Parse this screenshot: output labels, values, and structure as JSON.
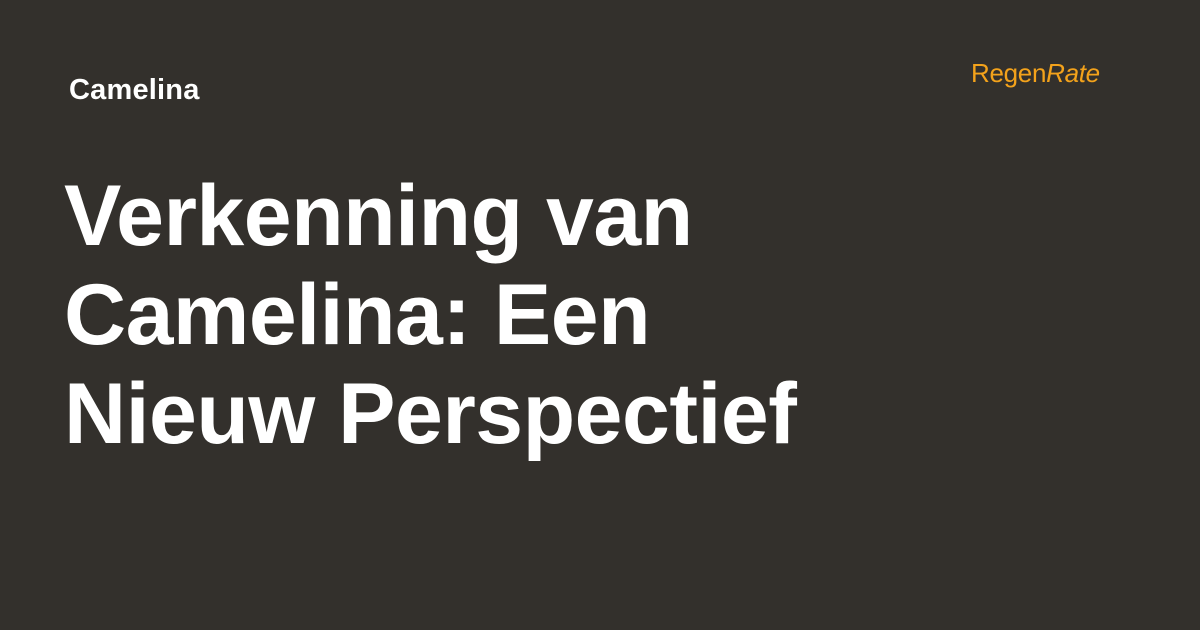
{
  "category": "Camelina",
  "logo": {
    "primary": "Regen",
    "secondary": "Rate"
  },
  "headline": {
    "lines": [
      "Verkenning van",
      "Camelina: Een",
      "Nieuw Perspectief"
    ]
  },
  "colors": {
    "background": "#33302c",
    "text": "#ffffff",
    "brand_accent": "#f3a21b"
  }
}
